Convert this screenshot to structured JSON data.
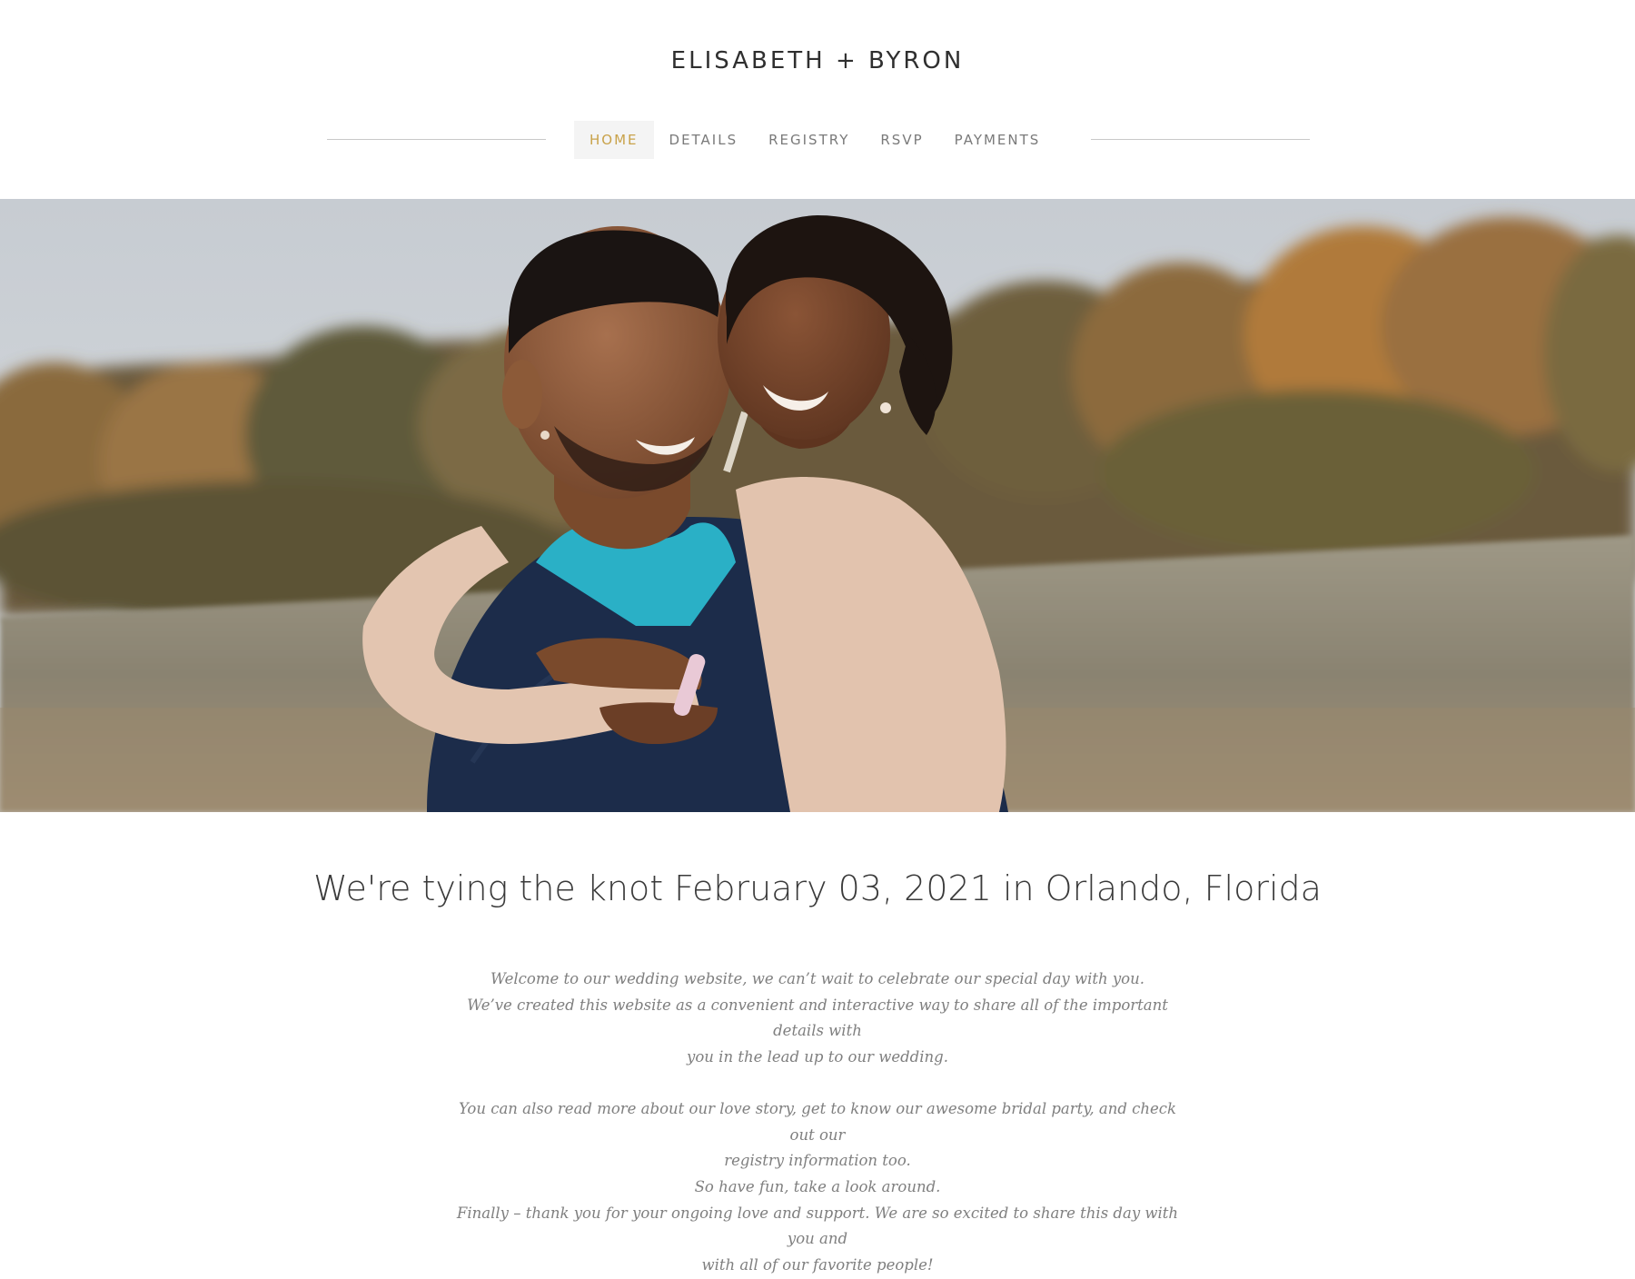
{
  "site": {
    "title": "ELISABETH + BYRON"
  },
  "nav": {
    "items": [
      {
        "label": "HOME",
        "active": true
      },
      {
        "label": "DETAILS",
        "active": false
      },
      {
        "label": "REGISTRY",
        "active": false
      },
      {
        "label": "RSVP",
        "active": false
      },
      {
        "label": "PAYMENTS",
        "active": false
      }
    ],
    "active_color": "#c9a24a"
  },
  "hero": {
    "photo": "couple-engagement-photo"
  },
  "main": {
    "headline": "We're tying the knot February 03, 2021 in Orlando, Florida",
    "welcome": {
      "line1": "Welcome to our wedding website, we can’t wait to celebrate our special day with you.",
      "line2": "We’ve created this website as a convenient and interactive way to share all of the important details with",
      "line3": "you in the lead up to our wedding.",
      "line4": "You can also read more about our love story, get to know our awesome bridal party, and check out our",
      "line5": "registry information too.",
      "line6": "So have fun, take a look around.",
      "line7": "Finally – thank you for your ongoing love and support. We are so excited to share this day with you and",
      "line8": "with all of our favorite people!"
    }
  }
}
